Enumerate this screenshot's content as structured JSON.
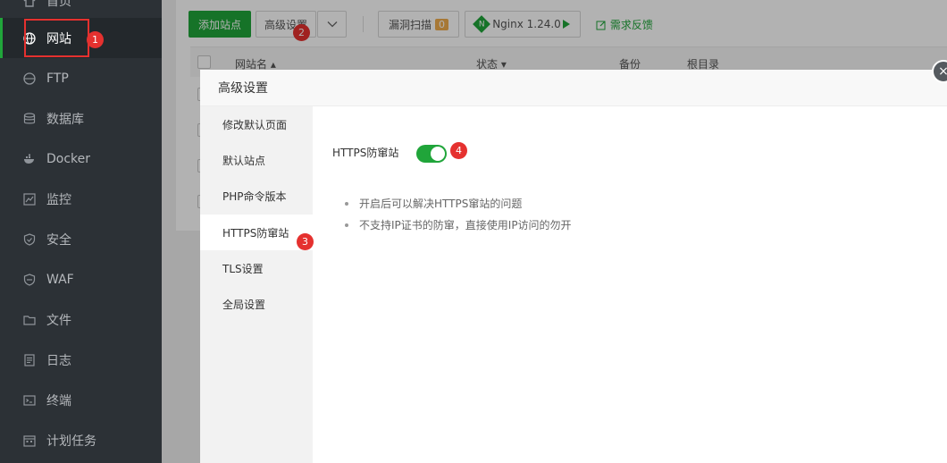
{
  "sidebar": {
    "items": [
      {
        "label": "首页",
        "icon": "home-icon"
      },
      {
        "label": "网站",
        "icon": "globe-icon",
        "active": true
      },
      {
        "label": "FTP",
        "icon": "ftp-icon"
      },
      {
        "label": "数据库",
        "icon": "database-icon"
      },
      {
        "label": "Docker",
        "icon": "docker-icon"
      },
      {
        "label": "监控",
        "icon": "monitor-icon"
      },
      {
        "label": "安全",
        "icon": "shield-icon"
      },
      {
        "label": "WAF",
        "icon": "waf-shield-icon"
      },
      {
        "label": "文件",
        "icon": "folder-icon"
      },
      {
        "label": "日志",
        "icon": "log-icon"
      },
      {
        "label": "终端",
        "icon": "terminal-icon"
      },
      {
        "label": "计划任务",
        "icon": "calendar-icon"
      }
    ]
  },
  "toolbar": {
    "add_site": "添加站点",
    "advanced": "高级设置",
    "vuln_scan": "漏洞扫描",
    "vuln_count": "0",
    "nginx": "Nginx 1.24.0",
    "feedback": "需求反馈"
  },
  "table": {
    "columns": [
      "网站名",
      "状态",
      "备份",
      "根目录"
    ]
  },
  "dialog": {
    "title": "高级设置",
    "nav": [
      {
        "label": "修改默认页面"
      },
      {
        "label": "默认站点"
      },
      {
        "label": "PHP命令版本"
      },
      {
        "label": "HTTPS防窜站",
        "active": true
      },
      {
        "label": "TLS设置"
      },
      {
        "label": "全局设置"
      }
    ],
    "setting_label": "HTTPS防窜站",
    "switch_on": true,
    "tips": [
      "开启后可以解决HTTPS窜站的问题",
      "不支持IP证书的防窜，直接使用IP访问的勿开"
    ],
    "close": "×"
  },
  "annotations": [
    "1",
    "2",
    "3",
    "4"
  ],
  "colors": {
    "accent": "#20a53a",
    "sidebar_bg": "#2c3136",
    "annotation_red": "#e5312f"
  }
}
